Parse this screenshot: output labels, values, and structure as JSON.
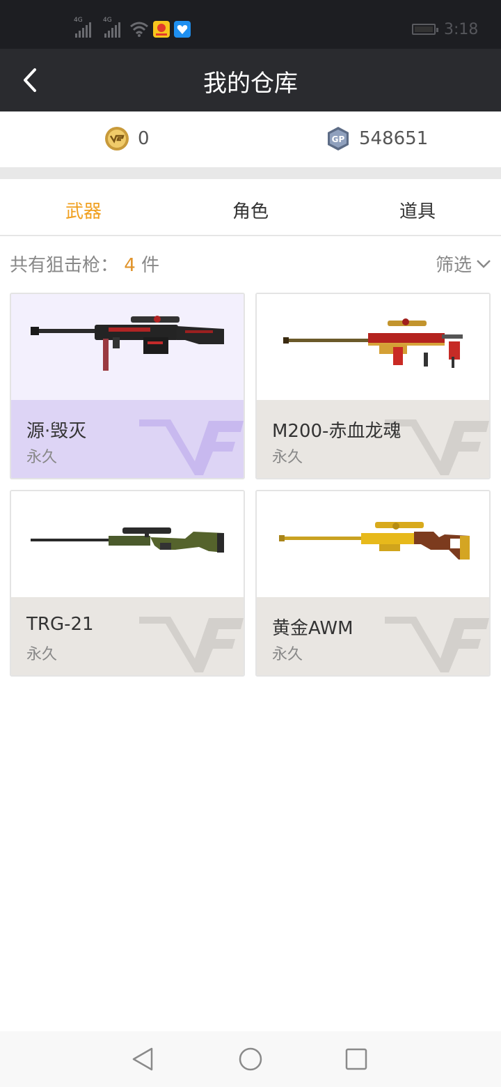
{
  "status_bar": {
    "signal1_tag": "4G",
    "signal2_tag": "4G",
    "time": "3:18"
  },
  "header": {
    "title": "我的仓库",
    "back_icon": "chevron-left-icon"
  },
  "currency": {
    "cf_coin": {
      "icon": "cf-coin-icon",
      "value": "0"
    },
    "gp": {
      "icon": "gp-coin-icon",
      "icon_text": "GP",
      "value": "548651"
    }
  },
  "tabs": [
    {
      "label": "武器",
      "active": true
    },
    {
      "label": "角色",
      "active": false
    },
    {
      "label": "道具",
      "active": false
    }
  ],
  "filter": {
    "count_label": "共有狙击枪：",
    "count_value": "4",
    "count_unit": "件",
    "filter_label": "筛选"
  },
  "items": [
    {
      "name": "源·毁灭",
      "duration": "永久",
      "selected": true,
      "image_icon": "black-red-sniper-rifle-icon"
    },
    {
      "name": "M200-赤血龙魂",
      "duration": "永久",
      "selected": false,
      "image_icon": "red-gold-sniper-rifle-icon"
    },
    {
      "name": "TRG-21",
      "duration": "永久",
      "selected": false,
      "image_icon": "green-sniper-rifle-icon"
    },
    {
      "name": "黄金AWM",
      "duration": "永久",
      "selected": false,
      "image_icon": "gold-sniper-rifle-icon"
    }
  ],
  "colors": {
    "accent": "#f0a020",
    "header_bg": "#2a2b2f",
    "selected_card": "#ddd4f5"
  }
}
